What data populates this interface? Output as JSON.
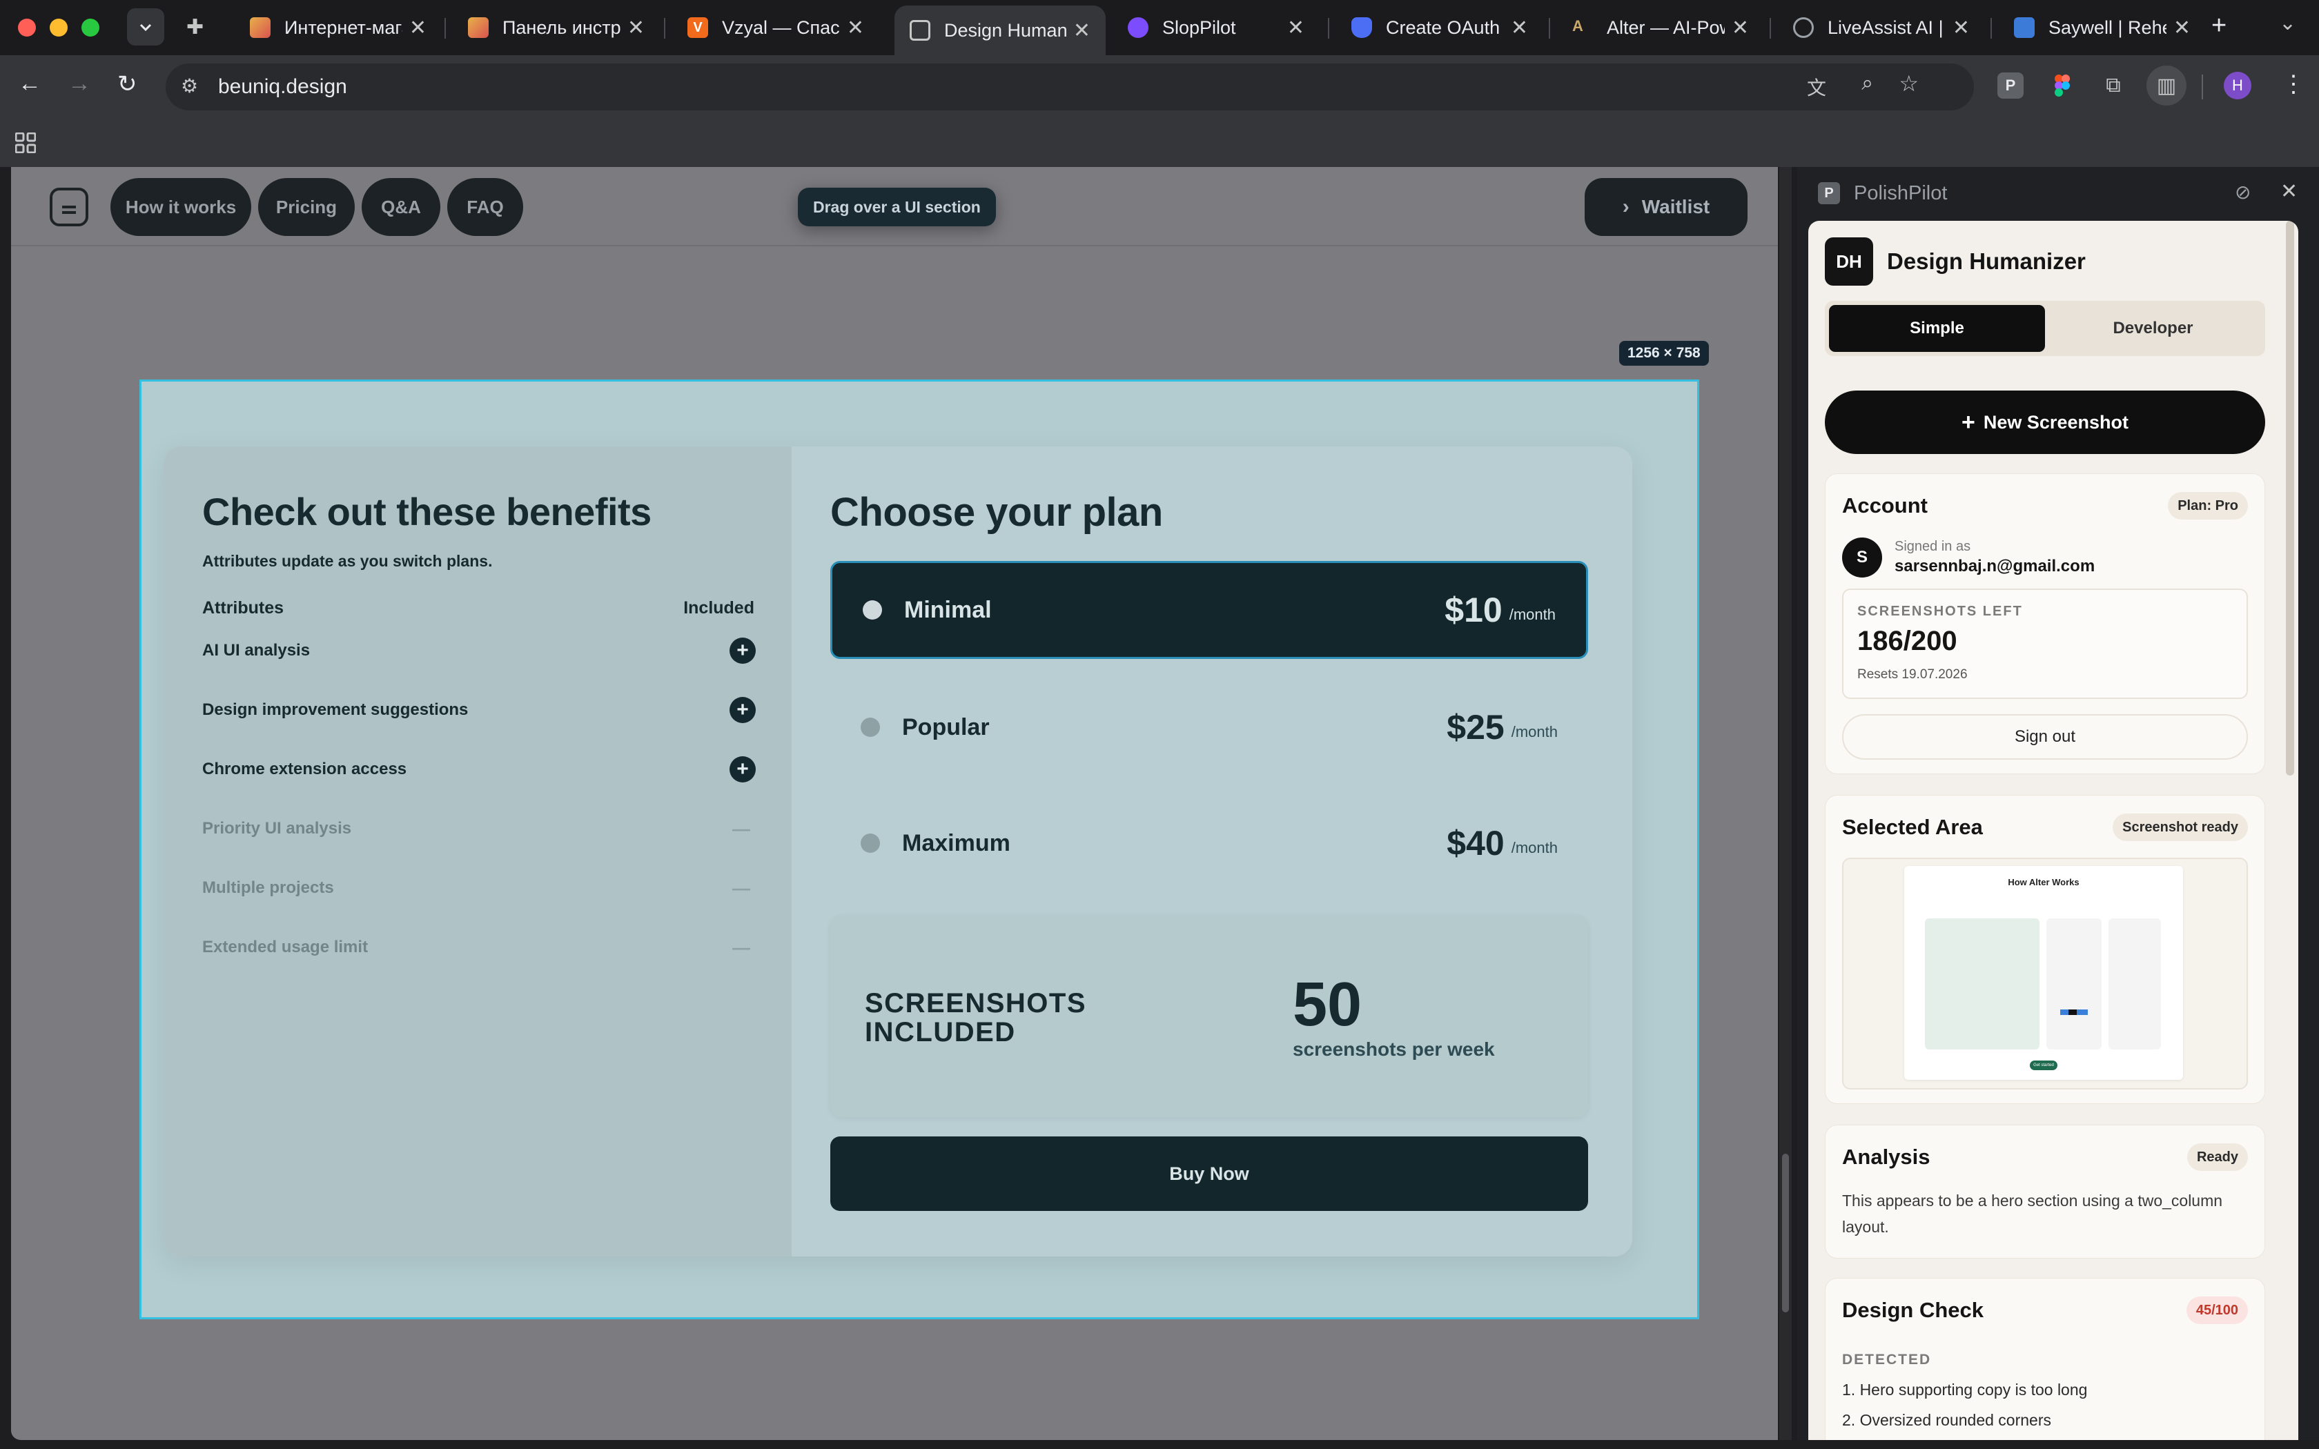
{
  "browser": {
    "tabs": [
      {
        "title": "Интернет-магаз",
        "favicon_color": "#e8b04a"
      },
      {
        "title": "Панель инстру",
        "favicon_color": "#d9534f"
      },
      {
        "title": "Vzyal — Спасаем",
        "favicon_color": "#f26b1d"
      },
      {
        "title": "Design Humaniz",
        "favicon_color": "#9aa0a6"
      },
      {
        "title": "SlopPilot",
        "favicon_color": "#7b4dff"
      },
      {
        "title": "Create OAuth c",
        "favicon_color": "#4c6ef5"
      },
      {
        "title": "Alter — AI-Pow",
        "favicon_color": "#caa86a"
      },
      {
        "title": "LiveAssist AI | F",
        "favicon_color": "#9aa0a6"
      },
      {
        "title": "Saywell | Rehea",
        "favicon_color": "#3d7bd9"
      }
    ],
    "url": "beuniq.design",
    "profile_initial": "H",
    "ext_p_letter": "P"
  },
  "site": {
    "nav": [
      "How it works",
      "Pricing",
      "Q&A",
      "FAQ"
    ],
    "drag_tip": "Drag over a UI section",
    "waitlist_label": "Waitlist",
    "waitlist_icon": "chevron-right-icon",
    "dimension_badge": "1256 × 758"
  },
  "benefits": {
    "title": "Check out these benefits",
    "subtitle": "Attributes update as you switch plans.",
    "col_attributes": "Attributes",
    "col_included": "Included",
    "rows": [
      {
        "label": "AI UI analysis",
        "included": true
      },
      {
        "label": "Design improvement suggestions",
        "included": true
      },
      {
        "label": "Chrome extension access",
        "included": true
      },
      {
        "label": "Priority UI analysis",
        "included": false
      },
      {
        "label": "Multiple projects",
        "included": false
      },
      {
        "label": "Extended usage limit",
        "included": false
      }
    ],
    "included_symbol": "+",
    "excluded_symbol": "—"
  },
  "plans": {
    "title": "Choose your plan",
    "options": [
      {
        "name": "Minimal",
        "price": "$10",
        "period": "/month",
        "selected": true
      },
      {
        "name": "Popular",
        "price": "$25",
        "period": "/month",
        "selected": false
      },
      {
        "name": "Maximum",
        "price": "$40",
        "period": "/month",
        "selected": false
      }
    ],
    "screenshots_label": "SCREENSHOTS INCLUDED",
    "screenshots_value": "50",
    "screenshots_sub": "screenshots per week",
    "buy_label": "Buy Now"
  },
  "panel": {
    "name": "PolishPilot",
    "icon_letter": "P",
    "app_logo": "DH",
    "app_title": "Design Humanizer",
    "modes": [
      "Simple",
      "Developer"
    ],
    "active_mode": "Simple",
    "new_screenshot": "New Screenshot",
    "account": {
      "title": "Account",
      "plan_badge": "Plan: Pro",
      "avatar_letter": "S",
      "signed_in_label": "Signed in as",
      "email": "sarsennbaj.n@gmail.com",
      "quota_label": "SCREENSHOTS LEFT",
      "quota_value": "186/200",
      "resets": "Resets 19.07.2026",
      "sign_out": "Sign out"
    },
    "selected_area": {
      "title": "Selected Area",
      "badge": "Screenshot ready",
      "preview_title": "How Alter Works",
      "preview_btn": "Get started"
    },
    "analysis": {
      "title": "Analysis",
      "badge": "Ready",
      "text": "This appears to be a hero section using a two_column layout."
    },
    "design_check": {
      "title": "Design Check",
      "score": "45/100",
      "detected_label": "DETECTED",
      "items": [
        "1. Hero supporting copy is too long",
        "2. Oversized rounded corners"
      ]
    }
  },
  "colors": {
    "selection_border": "#35bfe0",
    "dark_teal": "#13262b",
    "score_red": "#c0392b"
  }
}
